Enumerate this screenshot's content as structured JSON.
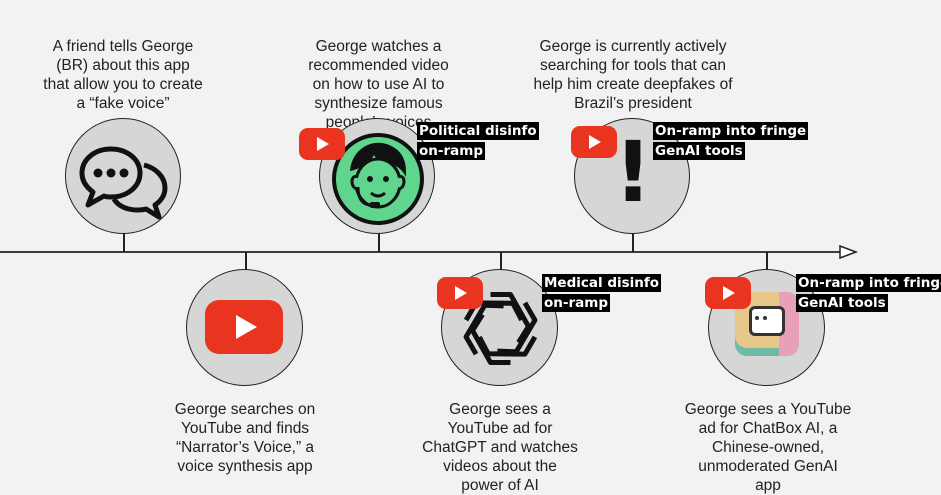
{
  "events": [
    {
      "caption": "A friend tells George (BR) about this app that allow you to create a “fake voice”",
      "icon": "speech-bubbles-icon"
    },
    {
      "caption": "George searches on YouTube and finds “Narrator’s Voice,” a voice synthesis app",
      "icon": "youtube-logo-icon"
    },
    {
      "caption": "George watches a recommended video on how to use AI to synthesize famous people’s voices",
      "icon": "green-operator-avatar-icon",
      "label_line1": "Political disinfo",
      "label_line2": "on-ramp"
    },
    {
      "caption": "George sees a YouTube ad for ChatGPT and watches videos about the power of AI",
      "icon": "openai-logo-icon",
      "label_line1": "Medical disinfo",
      "label_line2": "on-ramp"
    },
    {
      "caption": "George is currently actively searching for tools that can help him create deepfakes of Brazil’s president",
      "icon": "exclamation-icon",
      "label_line1": "On-ramp into fringe",
      "label_line2": "GenAI tools"
    },
    {
      "caption": "George sees a YouTube ad for ChatBox AI, a Chinese-owned, unmoderated GenAI app",
      "icon": "chatbox-app-icon",
      "label_line1": "On-ramp into fringe",
      "label_line2": "GenAI tools"
    }
  ],
  "colors": {
    "youtube_red": "#e93420",
    "avatar_green": "#5fd58d",
    "node_fill": "#d6d6d6",
    "label_bg": "#000000"
  }
}
